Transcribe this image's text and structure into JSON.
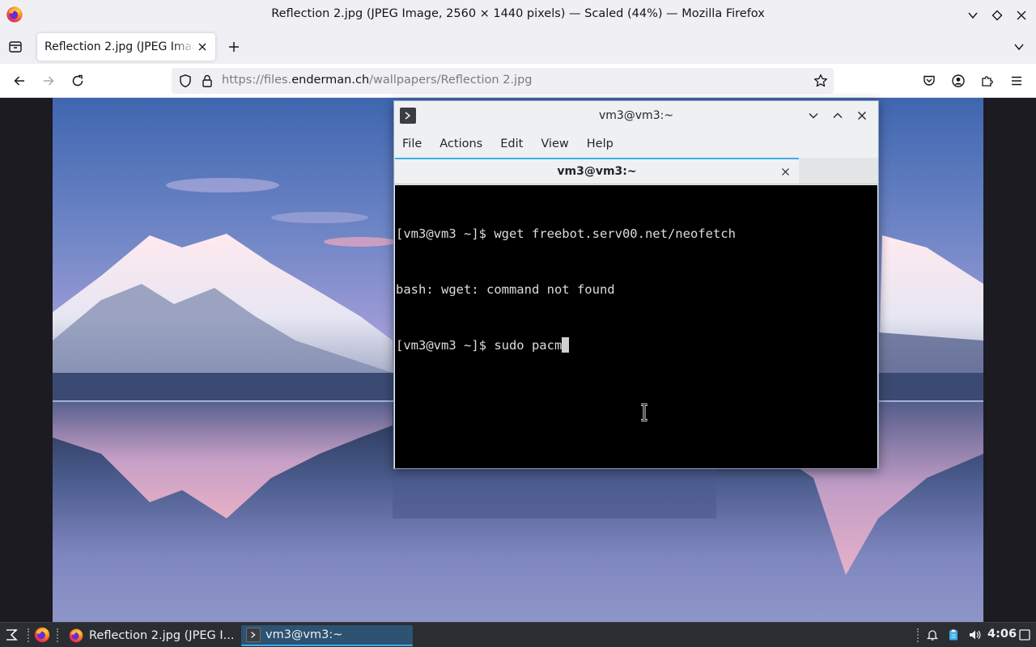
{
  "firefox": {
    "window_title": "Reflection 2.jpg (JPEG Image, 2560 × 1440 pixels) — Scaled (44%) — Mozilla Firefox",
    "tab_title": "Reflection 2.jpg (JPEG Image, 2560 × 1440 pixels)",
    "url_prefix": "https://files.",
    "url_host": "enderman.ch",
    "url_path": "/wallpapers/Reflection 2.jpg"
  },
  "terminal": {
    "window_title": "vm3@vm3:~",
    "menus": [
      "File",
      "Actions",
      "Edit",
      "View",
      "Help"
    ],
    "tab_label": "vm3@vm3:~",
    "lines": [
      "[vm3@vm3 ~]$ wget freebot.serv00.net/neofetch",
      "bash: wget: command not found",
      "[vm3@vm3 ~]$ sudo pacm"
    ]
  },
  "taskbar": {
    "tasks": [
      {
        "label": "Reflection 2.jpg (JPEG I...",
        "icon": "firefox-icon"
      },
      {
        "label": "vm3@vm3:~",
        "icon": "terminal-icon"
      }
    ],
    "clock": "4:06"
  },
  "colors": {
    "accent": "#3daee9",
    "taskbar_bg": "#2a2e32",
    "firefox_chrome": "#f0f0f4"
  }
}
